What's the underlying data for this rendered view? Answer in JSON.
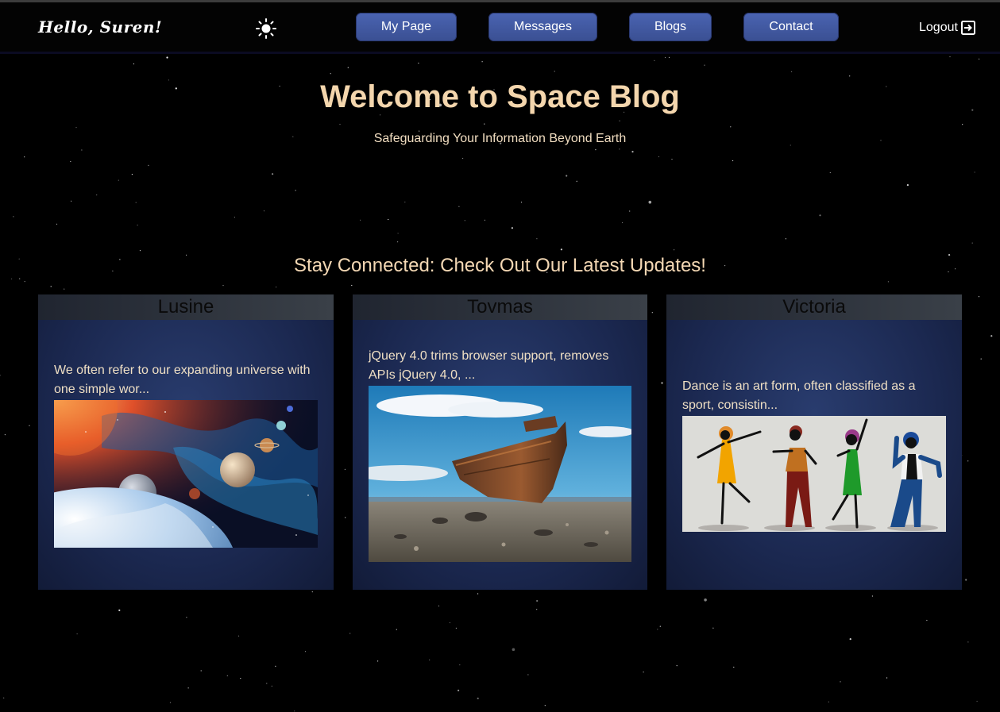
{
  "header": {
    "greeting": "Hello, Suren!",
    "nav": [
      "My Page",
      "Messages",
      "Blogs",
      "Contact"
    ],
    "logout_label": "Logout",
    "theme_icon": "sun-icon",
    "logout_icon": "exit-icon"
  },
  "hero": {
    "title": "Welcome to Space Blog",
    "subtitle": "Safeguarding Your Information Beyond Earth"
  },
  "section_title": "Stay Connected: Check Out Our Latest Updates!",
  "posts": [
    {
      "author": "Lusine",
      "excerpt": "We often refer to our expanding universe with one simple wor...",
      "image": "solar-system"
    },
    {
      "author": "Tovmas",
      "excerpt": "jQuery 4.0 trims browser support, removes APIs jQuery 4.0, ...",
      "image": "shipwreck"
    },
    {
      "author": "Victoria",
      "excerpt": "Dance is an art form, often classified as a sport, consistin...",
      "image": "dancers"
    }
  ],
  "colors": {
    "accent_button": "#4a64b2",
    "title_text": "#f4d6ad",
    "card_bg": "#1b2850",
    "background": "#000000"
  }
}
